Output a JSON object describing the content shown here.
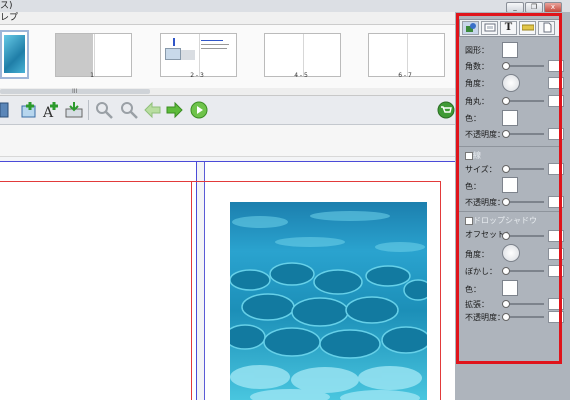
{
  "window": {
    "title_fragment": "ス)",
    "minimize_label": "_",
    "restore_label": "❐",
    "close_label": "x"
  },
  "menu": {
    "visible_item_fragment": "レプ"
  },
  "thumbnails": {
    "labels": [
      "1",
      "2 - 3",
      "4 - 5",
      "6 - 7"
    ],
    "scroll_grip": "III"
  },
  "toolbar": {
    "icons": [
      "page-icon",
      "add-image-icon",
      "add-text-icon",
      "insert-icon",
      "zoom-in-icon",
      "zoom-out-icon",
      "back-arrow-icon",
      "forward-arrow-icon",
      "play-icon",
      "cart-icon"
    ]
  },
  "panel": {
    "tabs": [
      "image-tab",
      "frame-tab",
      "text-tab",
      "ruler-tab",
      "page-tab"
    ],
    "text_tab_glyph": "T",
    "shape": {
      "shape_label": "図形：",
      "corner_count_label": "角数：",
      "angle_label": "角度：",
      "rounding_label": "角丸：",
      "color_label": "色：",
      "opacity_label": "不透明度："
    },
    "border": {
      "section_title": "線",
      "size_label": "サイズ：",
      "color_label": "色：",
      "opacity_label": "不透明度："
    },
    "shadow": {
      "section_title": "ドロップシャドウ",
      "offset_label": "オフセット：",
      "angle_label": "角度：",
      "blur_label": "ぼかし：",
      "color_label": "色：",
      "spread_label": "拡張：",
      "opacity_label": "不透明度："
    }
  }
}
